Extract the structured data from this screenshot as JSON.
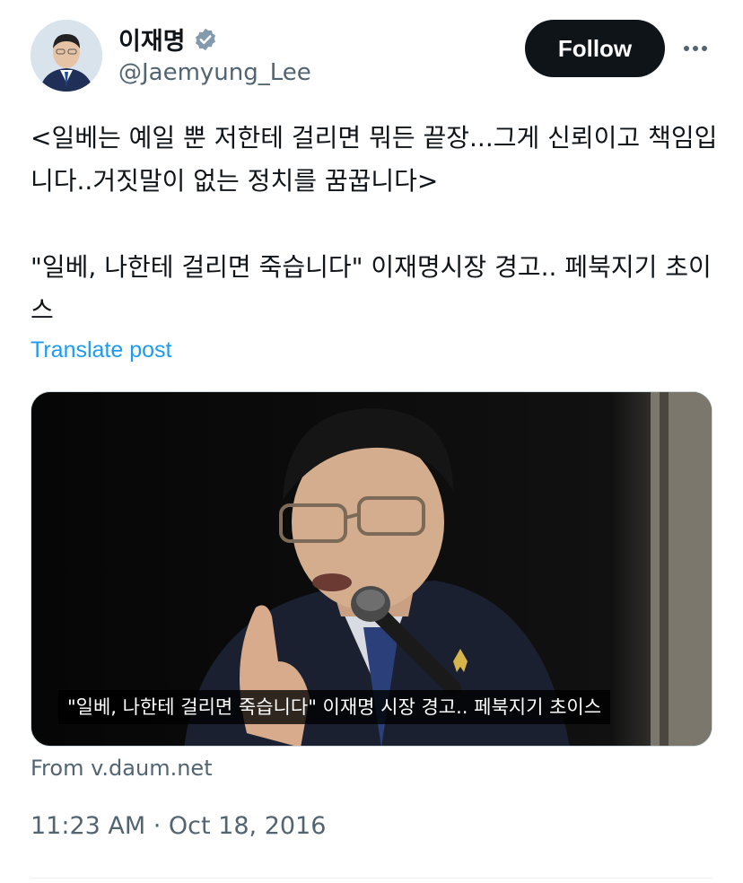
{
  "author": {
    "display_name": "이재명",
    "handle": "@Jaemyung_Lee",
    "verified_icon": "verified-badge-icon",
    "verified_color": "#829aab"
  },
  "header": {
    "follow_label": "Follow",
    "more_icon": "more-icon"
  },
  "tweet": {
    "line1": "<일베는 예일 뿐 저한테 걸리면 뭐든 끝장...그게 신뢰이고 책임입니다..거짓말이 없는 정치를 꿈꿉니다>",
    "line2": "\"일베, 나한테 걸리면 죽습니다\" 이재명시장 경고.. 페북지기 초이스",
    "translate_label": "Translate post"
  },
  "media": {
    "caption": "\"일베, 나한테 걸리면 죽습니다\" 이재명 시장 경고.. 페북지기 초이스",
    "source": "From v.daum.net"
  },
  "meta": {
    "timestamp": "11:23 AM · Oct 18, 2016"
  },
  "colors": {
    "text": "#0f1419",
    "secondary": "#536471",
    "link": "#1d9bf0",
    "button_bg": "#0f1419"
  }
}
